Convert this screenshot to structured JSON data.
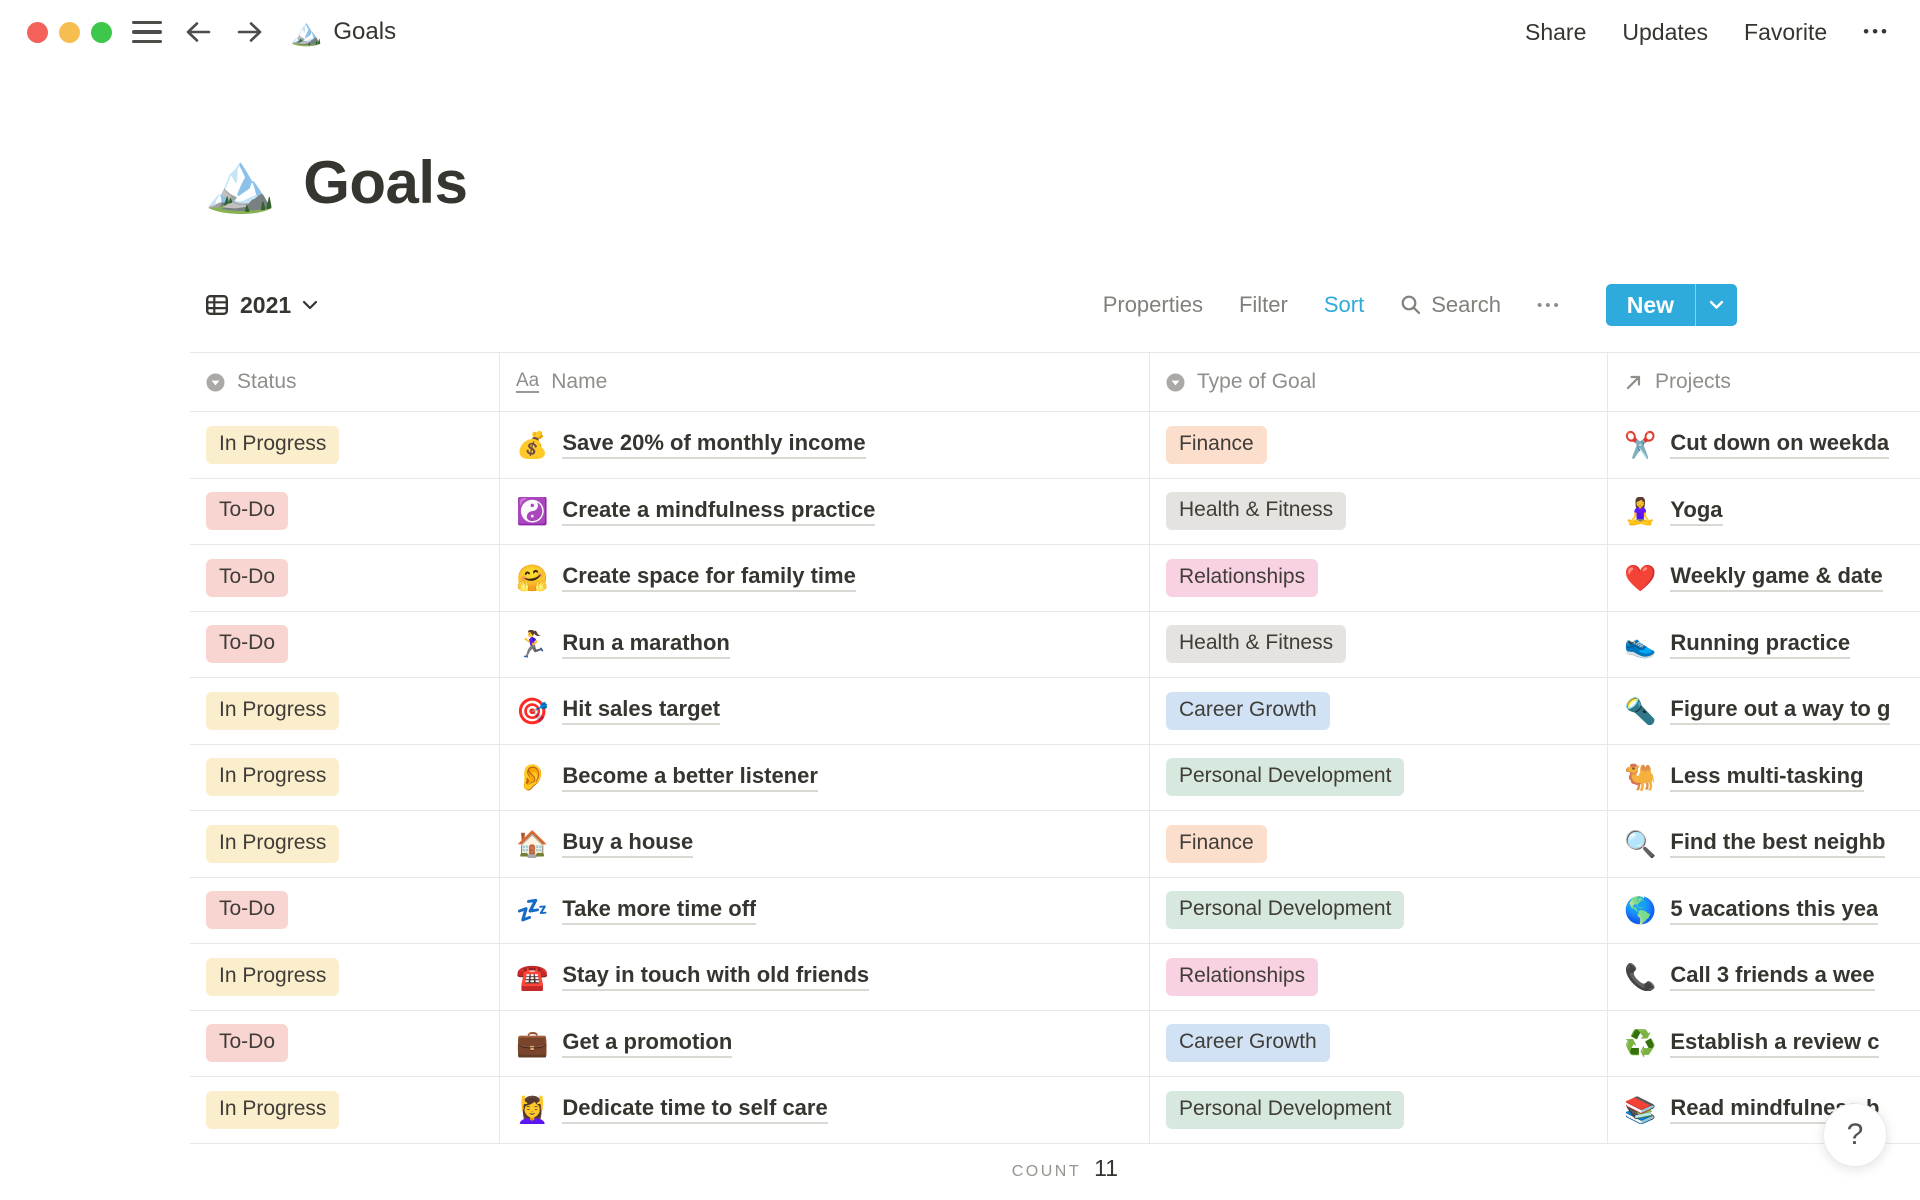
{
  "window": {
    "doc_icon": "🏔️",
    "doc_title": "Goals",
    "share": "Share",
    "updates": "Updates",
    "favorite": "Favorite",
    "more": "•••"
  },
  "page": {
    "icon": "🏔️",
    "title": "Goals"
  },
  "view_bar": {
    "view_name": "2021",
    "properties": "Properties",
    "filter": "Filter",
    "sort": "Sort",
    "search": "Search",
    "more": "•••",
    "new_label": "New"
  },
  "table": {
    "columns": [
      {
        "label": "Status",
        "icon": "select-icon"
      },
      {
        "label": "Name",
        "icon": "title-icon",
        "icon_text": "Aa"
      },
      {
        "label": "Type of Goal",
        "icon": "select-icon"
      },
      {
        "label": "Projects",
        "icon": "relation-icon"
      }
    ],
    "rows": [
      {
        "status": "In Progress",
        "name_emoji": "💰",
        "name": "Save 20% of monthly income",
        "type": "Finance",
        "project_emoji": "✂️",
        "project": "Cut down on weekda"
      },
      {
        "status": "To-Do",
        "name_emoji": "☯️",
        "name": "Create a mindfulness practice",
        "type": "Health & Fitness",
        "project_emoji": "🧘‍♀️",
        "project": "Yoga"
      },
      {
        "status": "To-Do",
        "name_emoji": "🤗",
        "name": "Create space for family time",
        "type": "Relationships",
        "project_emoji": "❤️",
        "project": "Weekly game & date"
      },
      {
        "status": "To-Do",
        "name_emoji": "🏃‍♀️",
        "name": "Run a marathon",
        "type": "Health & Fitness",
        "project_emoji": "👟",
        "project": "Running practice"
      },
      {
        "status": "In Progress",
        "name_emoji": "🎯",
        "name": "Hit sales target",
        "type": "Career Growth",
        "project_emoji": "🔦",
        "project": "Figure out a way to g"
      },
      {
        "status": "In Progress",
        "name_emoji": "👂",
        "name": "Become a better listener",
        "type": "Personal Development",
        "project_emoji": "🐫",
        "project": "Less multi-tasking"
      },
      {
        "status": "In Progress",
        "name_emoji": "🏠",
        "name": "Buy a house",
        "type": "Finance",
        "project_emoji": "🔍",
        "project": "Find the best neighb"
      },
      {
        "status": "To-Do",
        "name_emoji": "💤",
        "name": "Take more time off",
        "type": "Personal Development",
        "project_emoji": "🌎",
        "project": "5 vacations this yea"
      },
      {
        "status": "In Progress",
        "name_emoji": "☎️",
        "name": "Stay in touch with old friends",
        "type": "Relationships",
        "project_emoji": "📞",
        "project": "Call 3 friends a wee"
      },
      {
        "status": "To-Do",
        "name_emoji": "💼",
        "name": "Get a promotion",
        "type": "Career Growth",
        "project_emoji": "♻️",
        "project": "Establish a review c"
      },
      {
        "status": "In Progress",
        "name_emoji": "💆‍♀️",
        "name": "Dedicate time to self care",
        "type": "Personal Development",
        "project_emoji": "📚",
        "project": "Read mindfulness b"
      }
    ],
    "count_label": "COUNT",
    "count_value": "11"
  },
  "palette": {
    "In Progress": "#FBEECC",
    "To-Do": "#F9D5D2",
    "Finance": "#FBDECB",
    "Health & Fitness": "#E4E3E0",
    "Relationships": "#F8D2E3",
    "Career Growth": "#D0E2F4",
    "Personal Development": "#D7E9DE"
  },
  "colors": {
    "accent_blue": "#2EAADC"
  },
  "help": {
    "label": "?"
  }
}
